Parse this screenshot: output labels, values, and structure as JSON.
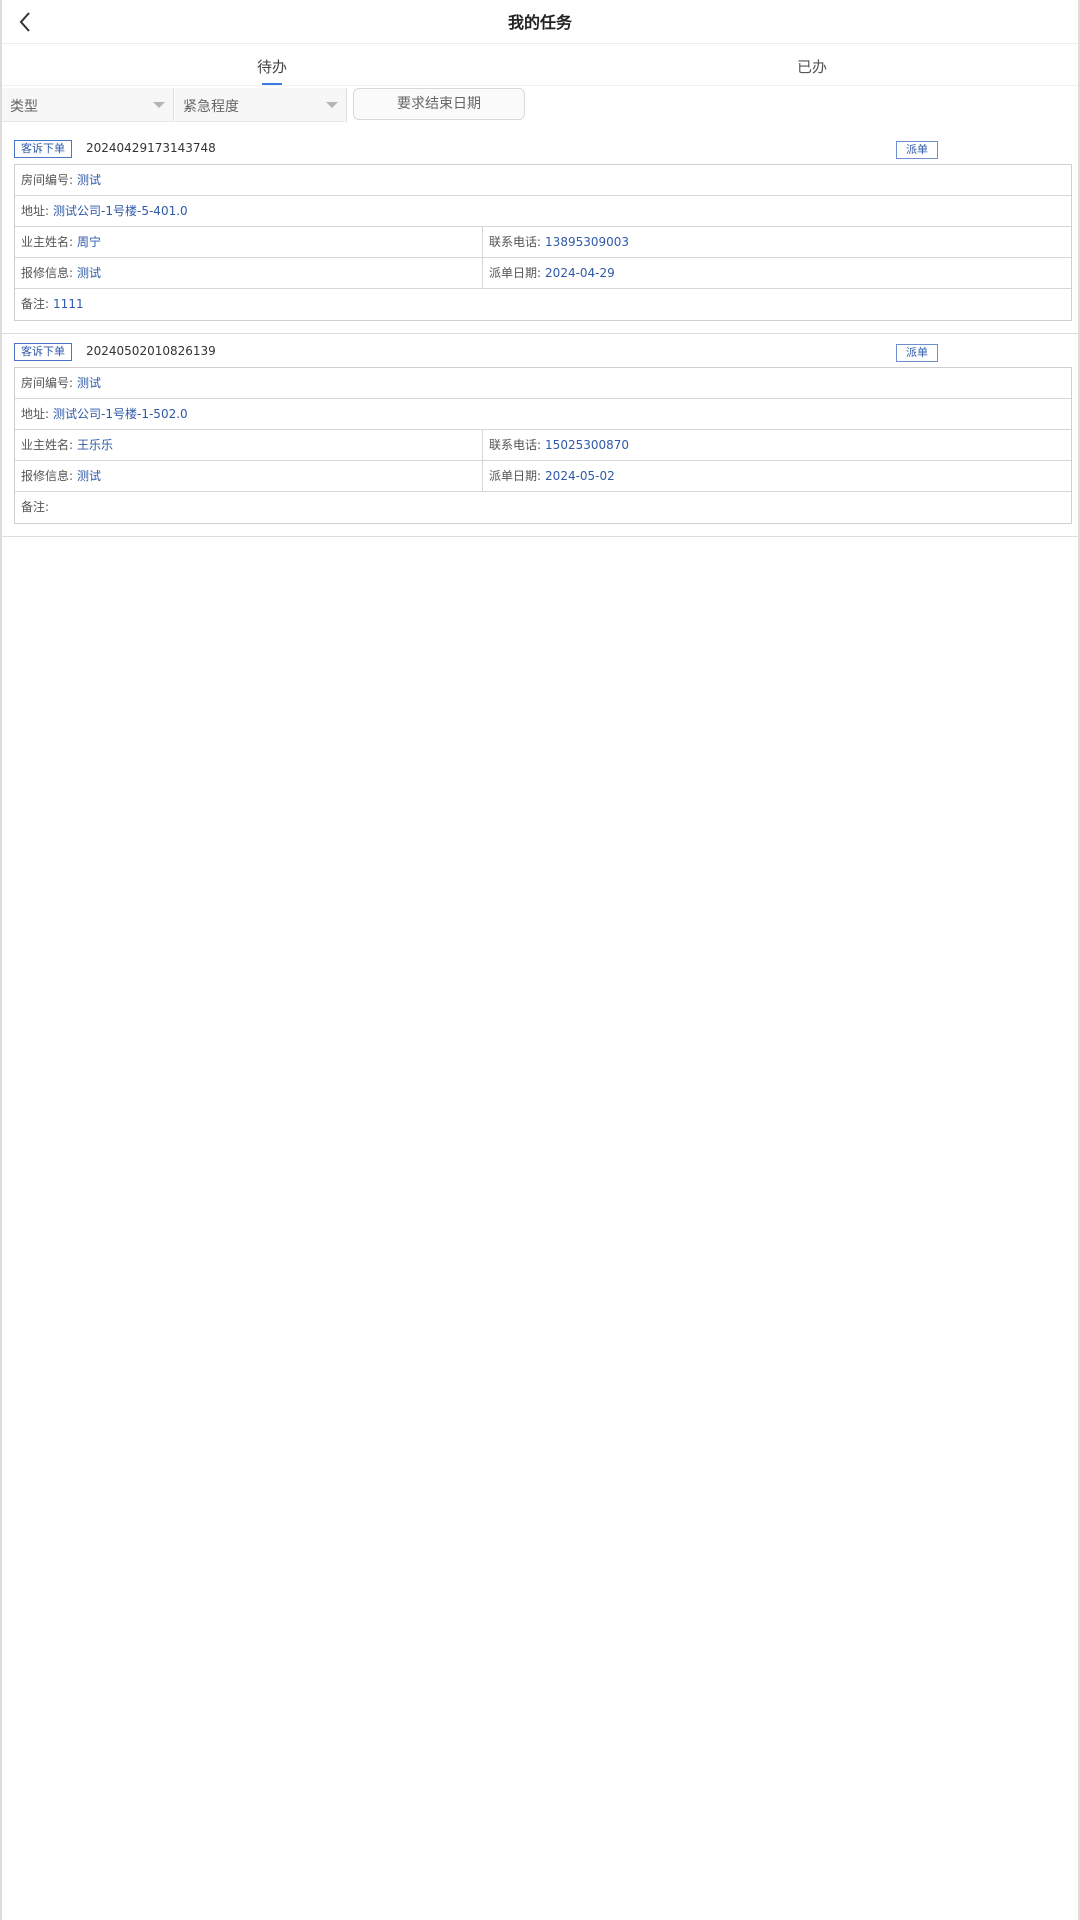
{
  "header": {
    "title": "我的任务"
  },
  "tabs": [
    {
      "label": "待办",
      "active": true
    },
    {
      "label": "已办",
      "active": false
    }
  ],
  "filters": {
    "type": "类型",
    "urgency": "紧急程度",
    "end_date": "要求结束日期"
  },
  "tasks": [
    {
      "type_tag": "客诉下单",
      "order_no": "20240429173143748",
      "action": "派单",
      "room_no_label": "房间编号:",
      "room_no": "测试",
      "address_label": "地址:",
      "address": "测试公司-1号楼-5-401.0",
      "owner_label": "业主姓名:",
      "owner": "周宁",
      "phone_label": "联系电话:",
      "phone": "13895309003",
      "repair_label": "报修信息:",
      "repair": "测试",
      "date_label": "派单日期:",
      "date": "2024-04-29",
      "remark_label": "备注:",
      "remark": "1111"
    },
    {
      "type_tag": "客诉下单",
      "order_no": "20240502010826139",
      "action": "派单",
      "room_no_label": "房间编号:",
      "room_no": "测试",
      "address_label": "地址:",
      "address": "测试公司-1号楼-1-502.0",
      "owner_label": "业主姓名:",
      "owner": "王乐乐",
      "phone_label": "联系电话:",
      "phone": "15025300870",
      "repair_label": "报修信息:",
      "repair": "测试",
      "date_label": "派单日期:",
      "date": "2024-05-02",
      "remark_label": "备注:",
      "remark": ""
    }
  ]
}
